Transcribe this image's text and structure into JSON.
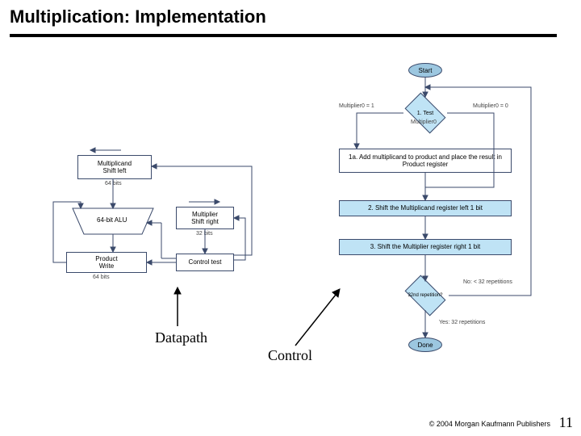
{
  "slide": {
    "title": "Multiplication:  Implementation",
    "footer": "© 2004 Morgan Kaufmann Publishers",
    "page": "11"
  },
  "datapath": {
    "multiplicand": "Multiplicand",
    "shift_left": "Shift left",
    "bits64a": "64 bits",
    "alu": "64-bit ALU",
    "multiplier": "Multiplier",
    "shift_right": "Shift right",
    "bits32": "32 bits",
    "product": "Product",
    "write": "Write",
    "control_test": "Control test",
    "bits64b": "64 bits",
    "label": "Datapath"
  },
  "control": {
    "start": "Start",
    "test_title": "1.  Test",
    "test_sub": "Multiplier0",
    "branch_eq1": "Multiplier0 = 1",
    "branch_eq0": "Multiplier0 = 0",
    "step1a": "1a.  Add multiplicand to product and place the result in Product register",
    "step2": "2.  Shift the Multiplicand register left 1 bit",
    "step3": "3.  Shift the Multiplier register right 1 bit",
    "rep_test": "32nd repetition?",
    "rep_no": "No: < 32 repetitions",
    "rep_yes": "Yes: 32 repetitions",
    "done": "Done",
    "label": "Control"
  }
}
